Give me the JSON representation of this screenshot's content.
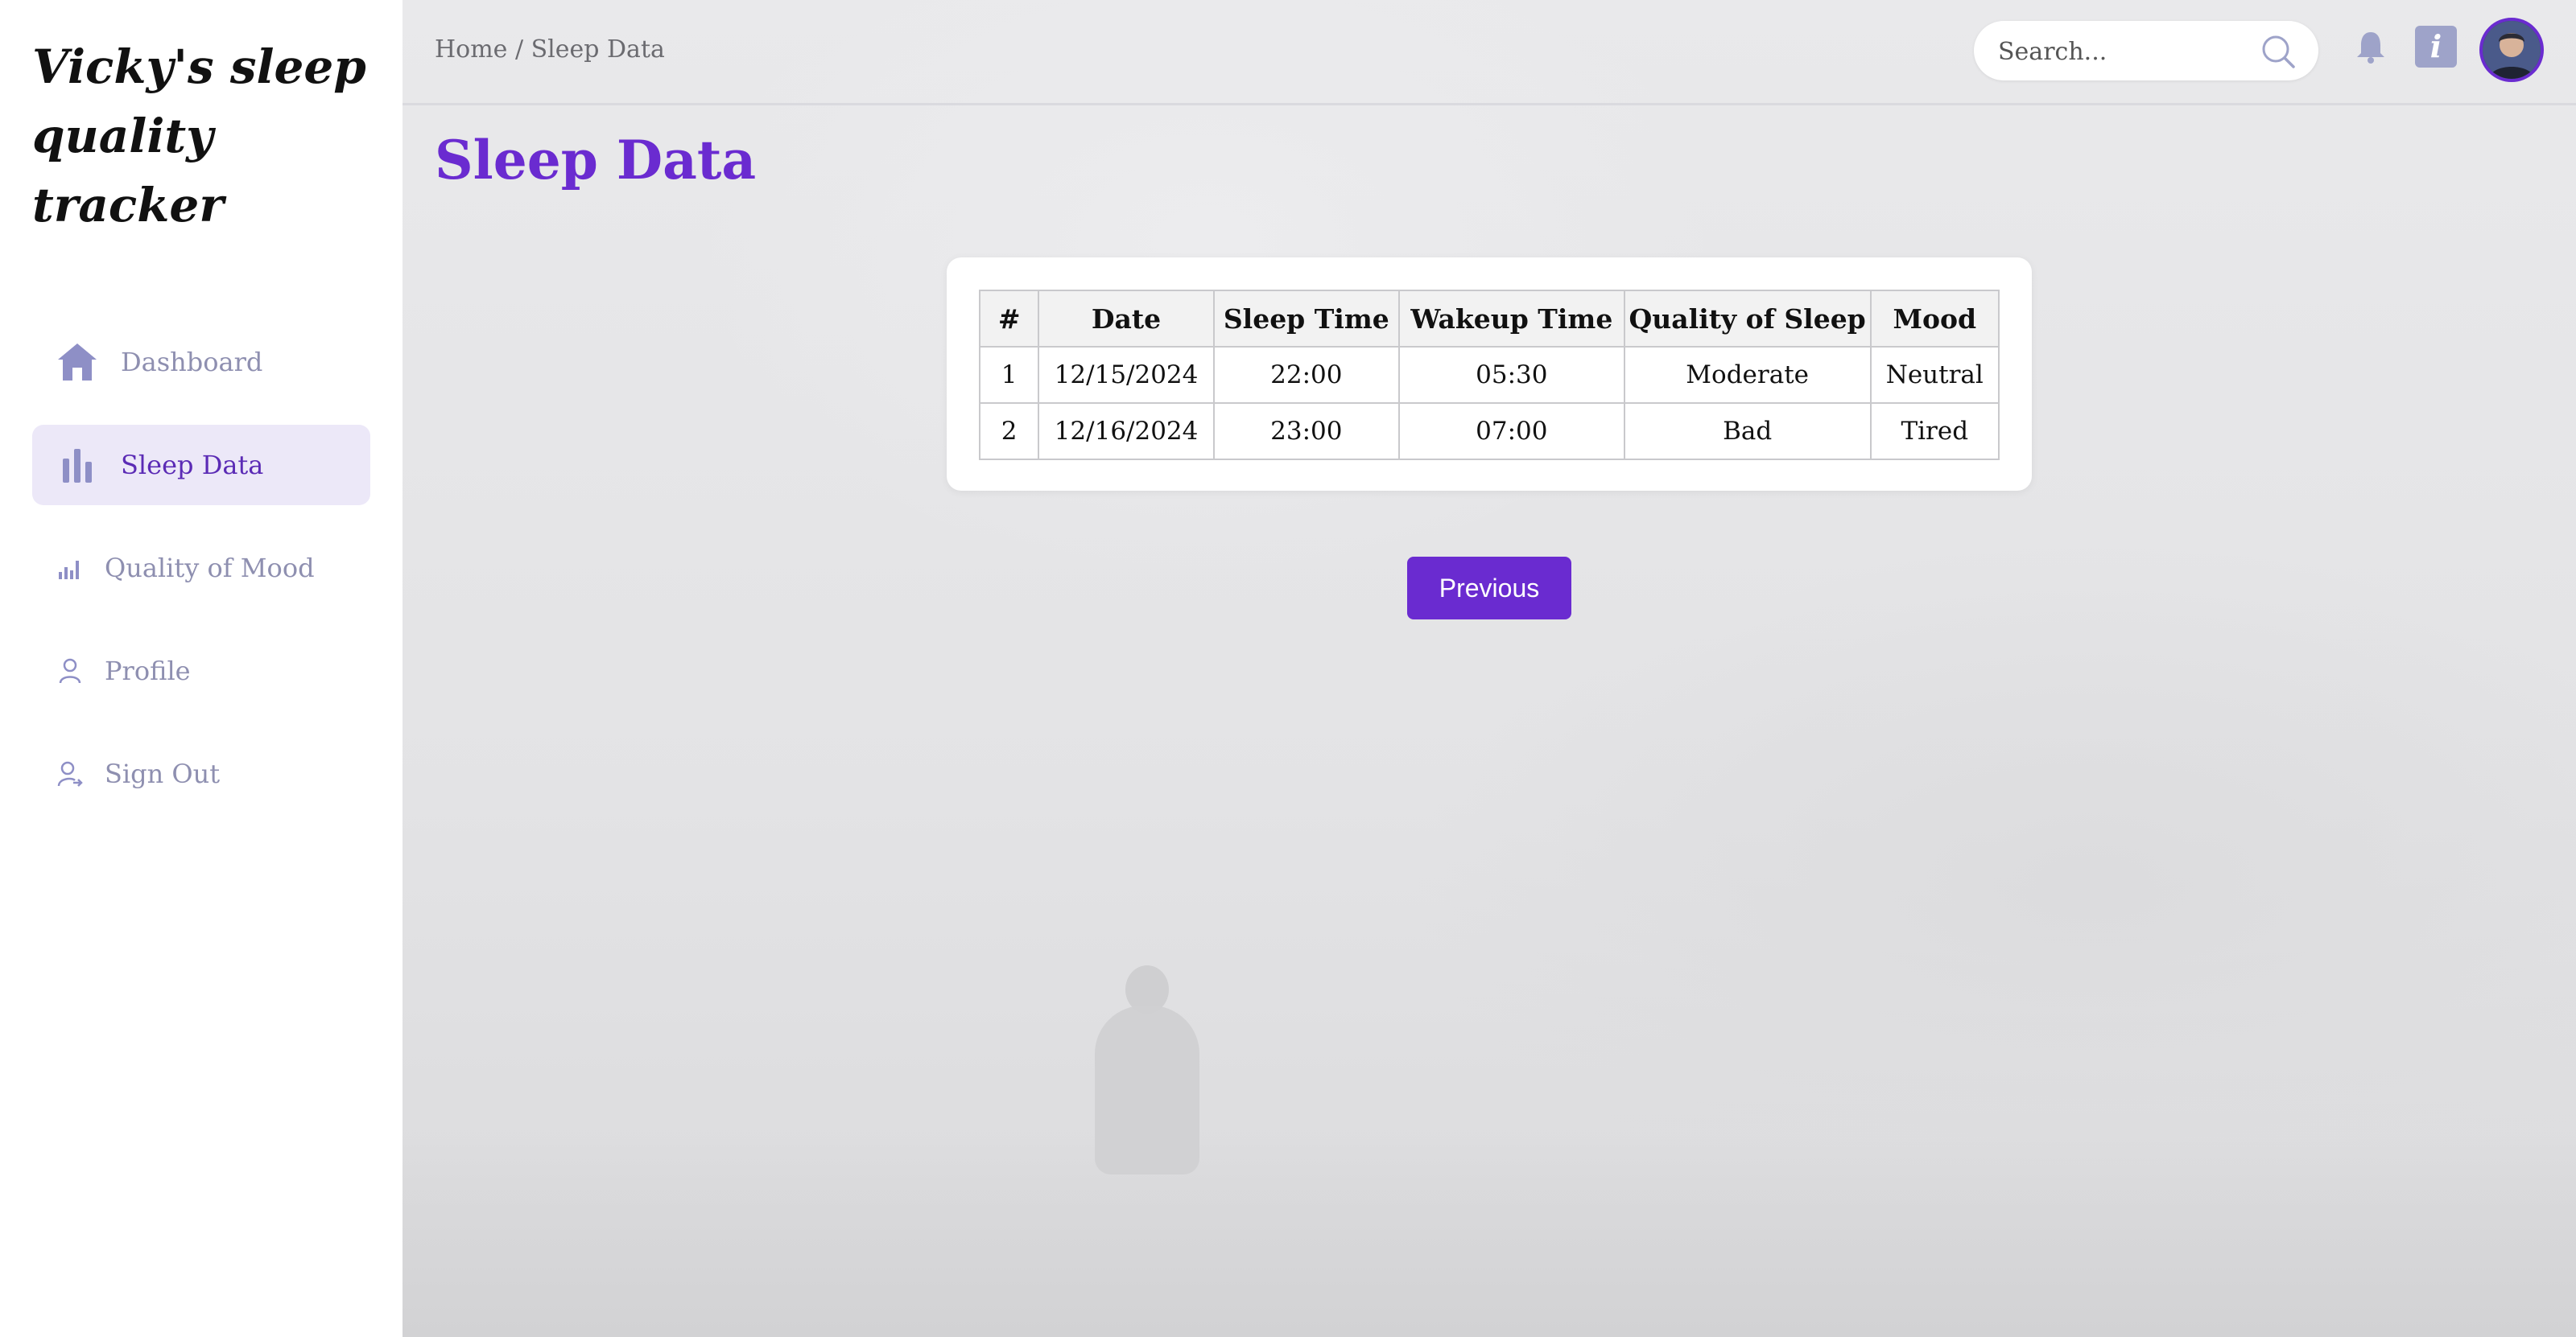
{
  "app": {
    "brand_title": "Vicky's sleep quality tracker"
  },
  "sidebar": {
    "items": [
      {
        "label": "Dashboard",
        "icon": "home-icon",
        "active": false
      },
      {
        "label": "Sleep Data",
        "icon": "bar-chart-icon",
        "active": true
      },
      {
        "label": "Quality of Mood",
        "icon": "signal-bars-icon",
        "active": false
      },
      {
        "label": "Profile",
        "icon": "user-icon",
        "active": false
      },
      {
        "label": "Sign Out",
        "icon": "user-sign-out-icon",
        "active": false
      }
    ]
  },
  "header": {
    "breadcrumb": "Home / Sleep Data",
    "search_placeholder": "Search...",
    "info_glyph": "i"
  },
  "page": {
    "title": "Sleep Data"
  },
  "table": {
    "columns": [
      "#",
      "Date",
      "Sleep Time",
      "Wakeup Time",
      "Quality of Sleep",
      "Mood"
    ],
    "rows": [
      [
        "1",
        "12/15/2024",
        "22:00",
        "05:30",
        "Moderate",
        "Neutral"
      ],
      [
        "2",
        "12/16/2024",
        "23:00",
        "07:00",
        "Bad",
        "Tired"
      ]
    ]
  },
  "pagination": {
    "previous_label": "Previous"
  },
  "colors": {
    "accent": "#6a2bd0",
    "nav_text": "#8e8fb0",
    "active_bg": "#ece8f8"
  }
}
